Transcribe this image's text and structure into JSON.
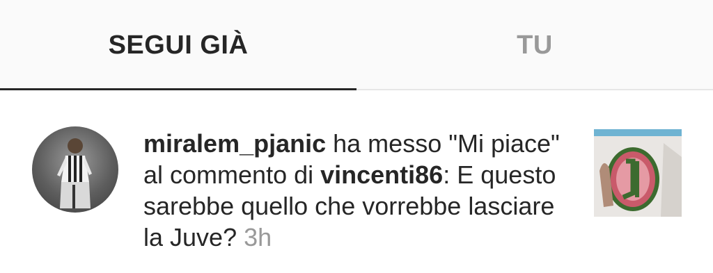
{
  "tabs": {
    "following": "SEGUI GIÀ",
    "you": "TU"
  },
  "notification": {
    "actor": "miralem_pjanic",
    "action_part1": "ha messo \"Mi piace\" al commento di",
    "target_user": "vincenti86",
    "colon": ":",
    "comment_text": "E questo sarebbe quello che vorrebbe lasciare la Juve?",
    "time": "3h",
    "avatar_icon": "user-avatar-photo",
    "thumbnail_icon": "post-thumbnail-photo"
  },
  "colors": {
    "text_primary": "#262626",
    "text_secondary": "#999999",
    "tab_background": "#fafafa"
  }
}
